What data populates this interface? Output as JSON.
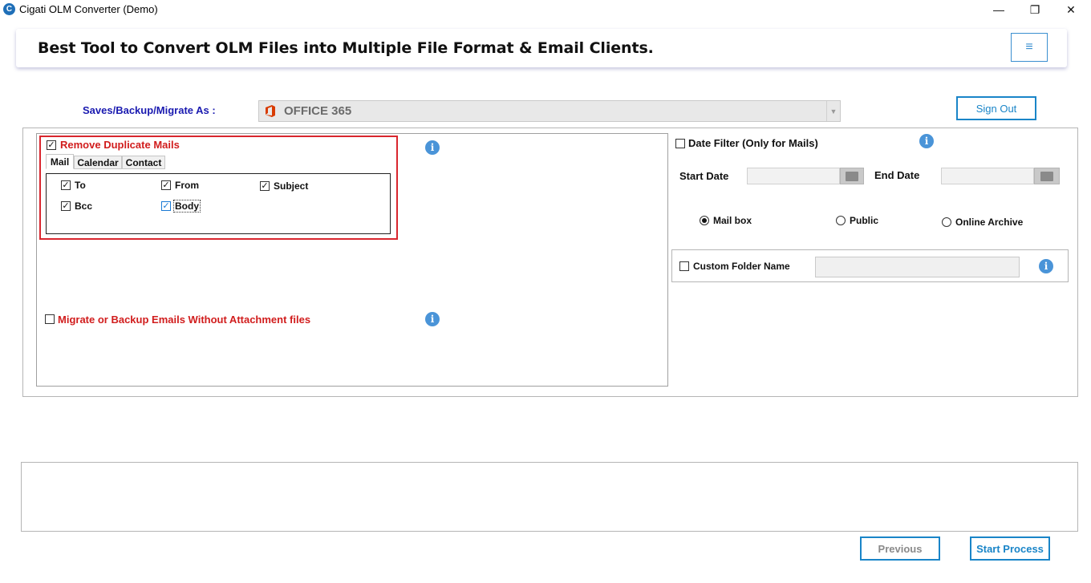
{
  "window": {
    "app_icon_glyph": "C",
    "title": "Cigati OLM Converter (Demo)",
    "minimize_glyph": "—",
    "maximize_glyph": "❐",
    "close_glyph": "✕"
  },
  "header": {
    "title": "Best Tool to Convert OLM Files into Multiple File Format & Email Clients.",
    "menu_glyph": "≡"
  },
  "save_as": {
    "label": "Saves/Backup/Migrate As :",
    "selected": "OFFICE 365",
    "arrow_glyph": "▼"
  },
  "sign_out_label": "Sign Out",
  "check_glyph": "✓",
  "info_glyph": "i",
  "duplicate": {
    "label": "Remove Duplicate Mails",
    "checked": true,
    "tabs": [
      {
        "label": "Mail",
        "active": true
      },
      {
        "label": "Calendar",
        "active": false
      },
      {
        "label": "Contact",
        "active": false
      }
    ],
    "options": [
      {
        "label": "To",
        "checked": true
      },
      {
        "label": "From",
        "checked": true
      },
      {
        "label": "Subject",
        "checked": true
      },
      {
        "label": "Bcc",
        "checked": true
      },
      {
        "label": "Body",
        "checked": true
      }
    ]
  },
  "attachment_option": {
    "label": "Migrate or Backup Emails Without Attachment files",
    "checked": false
  },
  "date_filter": {
    "label": "Date Filter  (Only for Mails)",
    "checked": false,
    "start_label": "Start Date",
    "end_label": "End Date",
    "start_value": "",
    "end_value": ""
  },
  "mailbox_type": {
    "options": [
      "Mail box",
      "Public",
      "Online Archive"
    ],
    "selected": "Mail box"
  },
  "custom_folder": {
    "label": "Custom Folder Name",
    "checked": false,
    "value": ""
  },
  "footer": {
    "previous_label": "Previous",
    "start_label": "Start Process"
  },
  "colors": {
    "accent_blue": "#1a85c8",
    "red_highlight": "#d9262e",
    "label_red": "#d11d1d",
    "label_navy": "#1a1ab0",
    "office_orange": "#d83b01"
  }
}
